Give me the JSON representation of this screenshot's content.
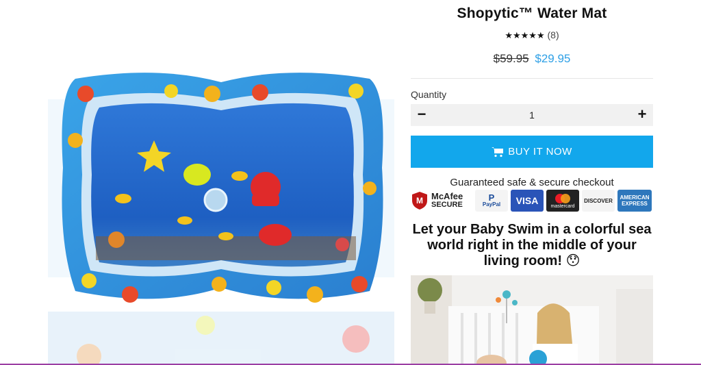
{
  "product": {
    "title": "Shopytic™ Water Mat",
    "stars": "★★★★★",
    "review_count": "(8)",
    "rating_value": 5,
    "old_price": "$59.95",
    "new_price": "$29.95"
  },
  "quantity": {
    "label": "Quantity",
    "minus": "−",
    "value": "1",
    "plus": "+"
  },
  "buy_button": {
    "label": "BUY IT NOW"
  },
  "secure": {
    "text": "Guaranteed safe & secure checkout",
    "badges": [
      {
        "name": "mcafee",
        "line1": "McAfee",
        "line2": "SECURE"
      },
      {
        "name": "paypal",
        "label": "PayPal"
      },
      {
        "name": "visa",
        "label": "VISA"
      },
      {
        "name": "mastercard",
        "label": "mastercard"
      },
      {
        "name": "discover",
        "label": "DISCOVER"
      },
      {
        "name": "amex",
        "line1": "AMERICAN",
        "line2": "EXPRESS"
      }
    ]
  },
  "headline": "Let your Baby Swim in a colorful sea world right in the middle of your living room! 😯",
  "colors": {
    "accent": "#12a7ec",
    "price": "#2ea0e6",
    "qty_bg": "#f1f1f1"
  }
}
